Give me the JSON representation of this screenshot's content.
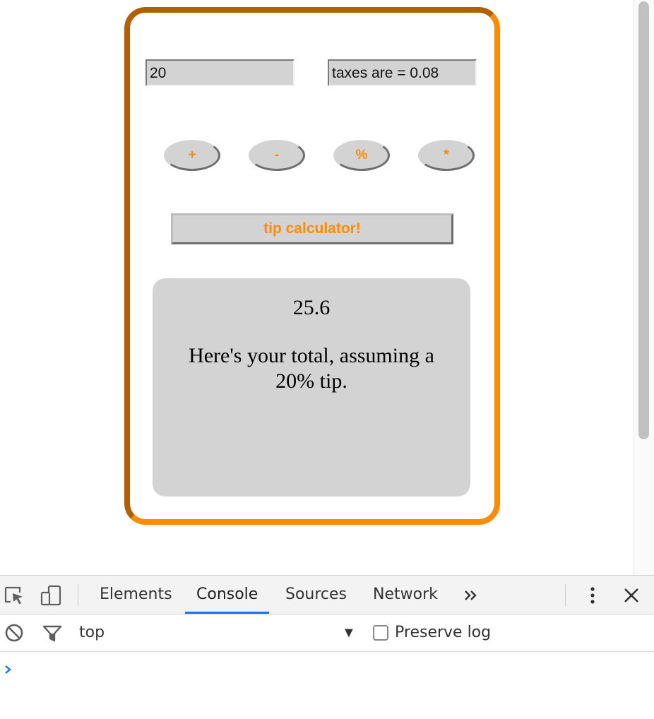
{
  "calculator": {
    "amount_value": "20",
    "taxes_value": "taxes are = 0.08",
    "operators": [
      "+",
      "-",
      "%",
      "*"
    ],
    "tip_button_label": "tip calculator!",
    "result_value": "25.6",
    "result_message": "Here's your total, assuming a 20% tip."
  },
  "devtools": {
    "tabs": [
      "Elements",
      "Console",
      "Sources",
      "Network"
    ],
    "active_tab": "Console",
    "more_tabs_icon": "double-chevron-right-icon",
    "context": "top",
    "preserve_log_label": "Preserve log",
    "preserve_log_checked": false,
    "prompt_icon": "chevron-right-icon"
  },
  "colors": {
    "accent": "#ff8c00",
    "border_dark": "#b35f00",
    "panel": "#d3d3d3",
    "active_tab_underline": "#1a73e8",
    "prompt": "#1a73e8"
  }
}
